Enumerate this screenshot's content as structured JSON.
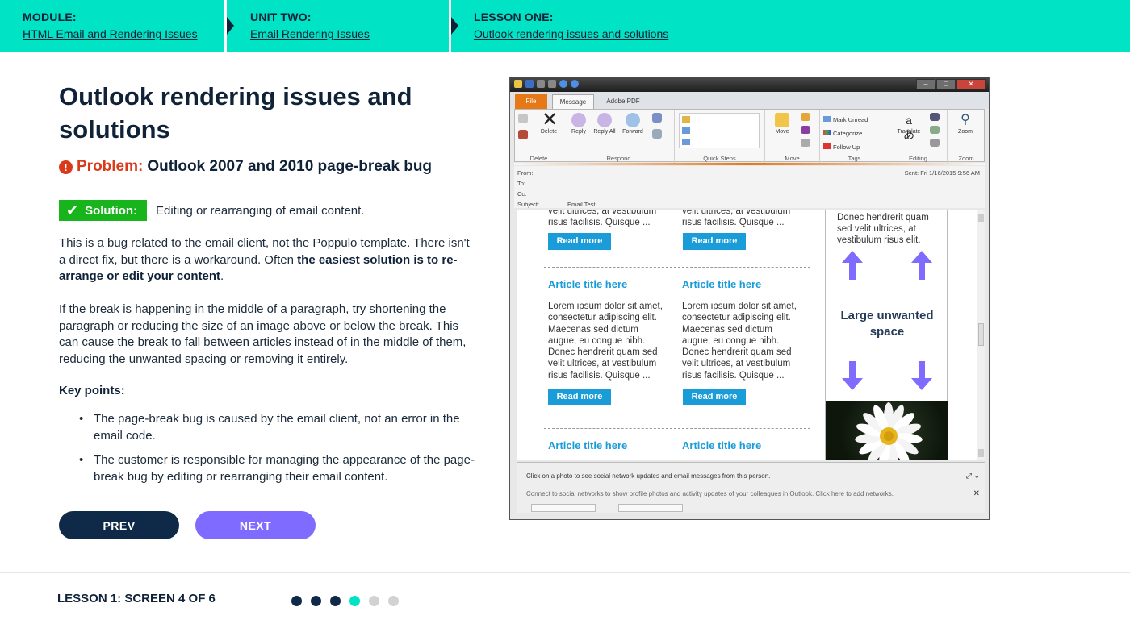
{
  "breadcrumb": {
    "module": {
      "label": "MODULE:",
      "link": "HTML Email and Rendering Issues"
    },
    "unit": {
      "label": "UNIT TWO:",
      "link": "Email Rendering Issues"
    },
    "lesson": {
      "label": "LESSON ONE:",
      "link": "Outlook rendering issues and solutions"
    }
  },
  "page": {
    "title": "Outlook rendering issues and solutions",
    "problem": {
      "icon": "alert-icon",
      "label": "Problem:",
      "text": "Outlook 2007 and 2010 page-break bug"
    },
    "solution": {
      "label": "Solution:",
      "text": "Editing or rearranging of email content."
    },
    "paragraph1": {
      "text1": "This is a bug related to the email client, not the Poppulo template. There isn't a direct fix, but there is a workaround. Often ",
      "bold": "the easiest solution is to re-arrange or edit your content",
      "text2": "."
    },
    "paragraph2": "If the break is happening in the middle of a paragraph, try shortening the paragraph or reducing the size of an image above or below the break. This can cause the break to fall between articles instead of in the middle of them, reducing the unwanted spacing or removing it entirely.",
    "key_points_heading": "Key points:",
    "key_points": [
      "The page-break bug is caused by the email client, not an error in the email code.",
      "The customer is responsible for managing the appearance of the page-break bug by editing or rearranging their email content."
    ]
  },
  "nav": {
    "prev": "PREV",
    "next": "NEXT"
  },
  "footer": {
    "label": "LESSON 1: SCREEN 4 OF 6",
    "total_screens": 6,
    "current_screen": 4
  },
  "colors": {
    "header_bg": "#00e3c4",
    "navy": "#0f2238",
    "problem_red": "#d93a1a",
    "solution_green": "#17b51b",
    "next_purple": "#7f6bff",
    "dot_done": "#0f2a48",
    "dot_current": "#00e3c4",
    "dot_todo": "#d2d2d2",
    "article_blue": "#1a9cd8",
    "arrow_purple": "#7f6bff"
  },
  "outlook": {
    "tabs": [
      "File",
      "Message",
      "Adobe PDF"
    ],
    "ribbon_buttons": {
      "delete": "Delete",
      "reply": "Reply",
      "reply_all": "Reply All",
      "forward": "Forward",
      "move": "Move",
      "mark_unread": "Mark Unread",
      "categorize": "Categorize",
      "follow_up": "Follow Up",
      "translate": "Translate",
      "zoom": "Zoom"
    },
    "ribbon_groups": [
      "Delete",
      "Respond",
      "Quick Steps",
      "Move",
      "Tags",
      "Editing",
      "Zoom"
    ],
    "header_fields": {
      "from": "From:",
      "to": "To:",
      "cc": "Cc:",
      "subject_label": "Subject:",
      "subject": "Email Test",
      "sent_label": "Sent:",
      "sent": "Fri 1/16/2015 9:56 AM"
    },
    "email": {
      "top_snippet_line1": "velit ultrices, at vestibulum",
      "top_snippet_line2": "risus facilisis. Quisque ...",
      "read_more": "Read more",
      "article_title": "Article title here",
      "article_body": "Lorem ipsum dolor sit amet, consectetur adipiscing elit. Maecenas sed dictum augue, eu congue nibh. Donec hendrerit quam sed velit ultrices, at vestibulum risus facilisis. Quisque ...",
      "sidebar_text": "Donec hendrerit quam sed velit ultrices, at vestibulum risus elit.",
      "annotation": "Large unwanted space"
    },
    "people_pane": {
      "line1": "Click on a photo to see social network updates and email messages from this person.",
      "line2": "Connect to social networks to show profile photos and activity updates of your colleagues in Outlook. Click here to add networks."
    }
  }
}
